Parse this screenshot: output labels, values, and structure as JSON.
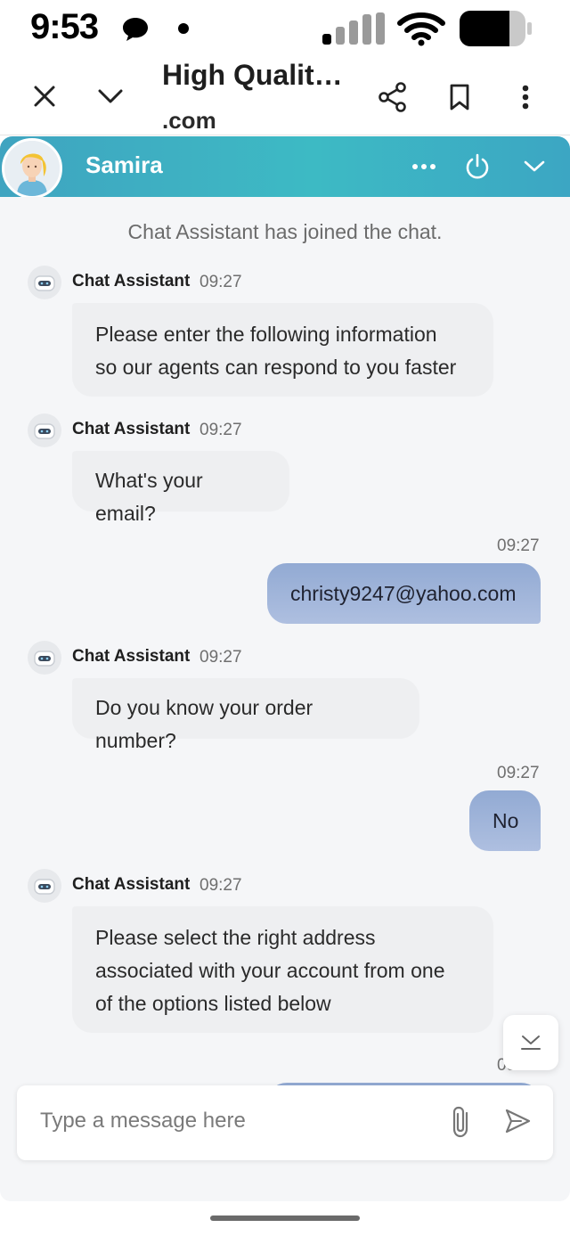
{
  "status_bar": {
    "time": "9:53"
  },
  "browser": {
    "title": "High Qualit…",
    "domain": ".com",
    "icons": [
      "close-icon",
      "chevron-down-icon",
      "share-icon",
      "bookmark-icon",
      "more-vertical-icon"
    ]
  },
  "chat": {
    "agent_name": "Samira",
    "system_message": "Chat Assistant has joined the chat.",
    "messages": [
      {
        "sender": "Chat Assistant",
        "time": "09:27",
        "text_line1": "Please enter the following information",
        "text_line2": "so our agents can respond to you faster"
      },
      {
        "sender": "Chat Assistant",
        "time": "09:27",
        "text": "What's your email?"
      },
      {
        "sender": "user",
        "time": "09:27",
        "text": "christy9247@yahoo.com"
      },
      {
        "sender": "Chat Assistant",
        "time": "09:27",
        "text": "Do you know your order number?"
      },
      {
        "sender": "user",
        "time": "09:27",
        "text": "No"
      },
      {
        "sender": "Chat Assistant",
        "time": "09:27",
        "text_line1": "Please select the right address",
        "text_line2": "associated with your account from one",
        "text_line3": "of the options listed below"
      },
      {
        "sender": "user",
        "time": "09:27"
      }
    ],
    "input_placeholder": "Type a message here"
  },
  "colors": {
    "header_gradient_start": "#3fa4c0",
    "header_gradient_mid": "#3dbac4",
    "user_bubble": "#a3b7dc",
    "bot_bubble": "#eeeff1",
    "chat_background": "#f5f6f8"
  }
}
